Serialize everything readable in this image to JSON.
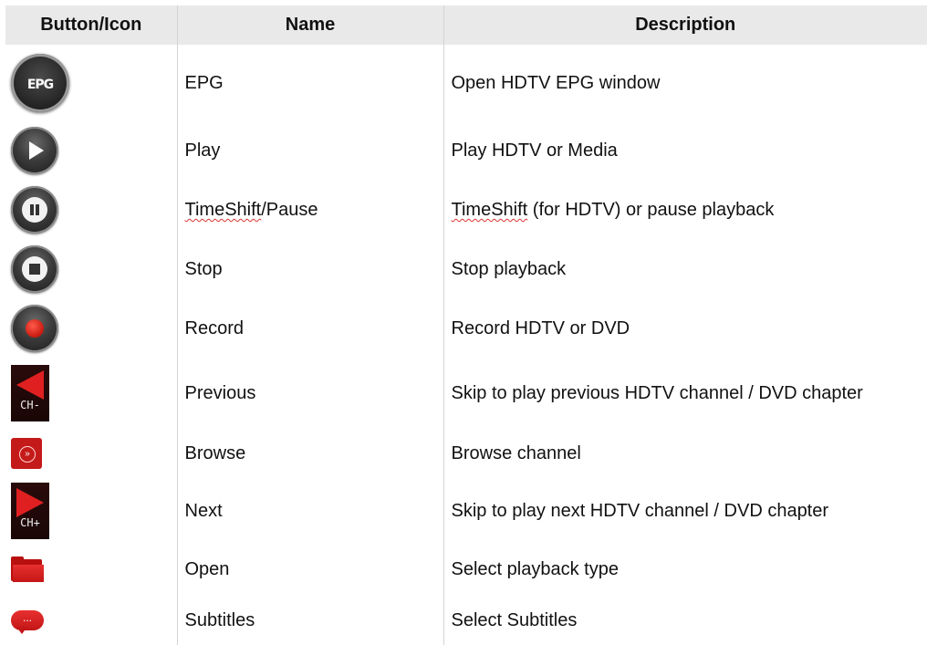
{
  "table": {
    "headers": [
      "Button/Icon",
      "Name",
      "Description"
    ],
    "rows": [
      {
        "icon": "epg-icon",
        "icon_text": "EPG",
        "name": "EPG",
        "description": "Open HDTV EPG window"
      },
      {
        "icon": "play-icon",
        "name": "Play",
        "description": "Play HDTV or Media"
      },
      {
        "icon": "pause-icon",
        "name_parts": [
          "TimeShift",
          "/Pause"
        ],
        "description_parts": [
          "TimeShift",
          " (for HDTV) or pause playback"
        ]
      },
      {
        "icon": "stop-icon",
        "name": "Stop",
        "description": "Stop playback"
      },
      {
        "icon": "record-icon",
        "name": "Record",
        "description": "Record HDTV or DVD"
      },
      {
        "icon": "channel-previous-icon",
        "icon_text": "CH-",
        "name": "Previous",
        "description": "Skip to play previous HDTV channel / DVD chapter"
      },
      {
        "icon": "browse-icon",
        "icon_text": "»",
        "name": "Browse",
        "description": "Browse channel"
      },
      {
        "icon": "channel-next-icon",
        "icon_text": "CH+",
        "name": "Next",
        "description": "Skip to play next HDTV channel / DVD chapter"
      },
      {
        "icon": "folder-icon",
        "name": "Open",
        "description": "Select playback type"
      },
      {
        "icon": "subtitles-icon",
        "icon_text": "...",
        "name": "Subtitles",
        "description": "Select Subtitles"
      }
    ]
  }
}
